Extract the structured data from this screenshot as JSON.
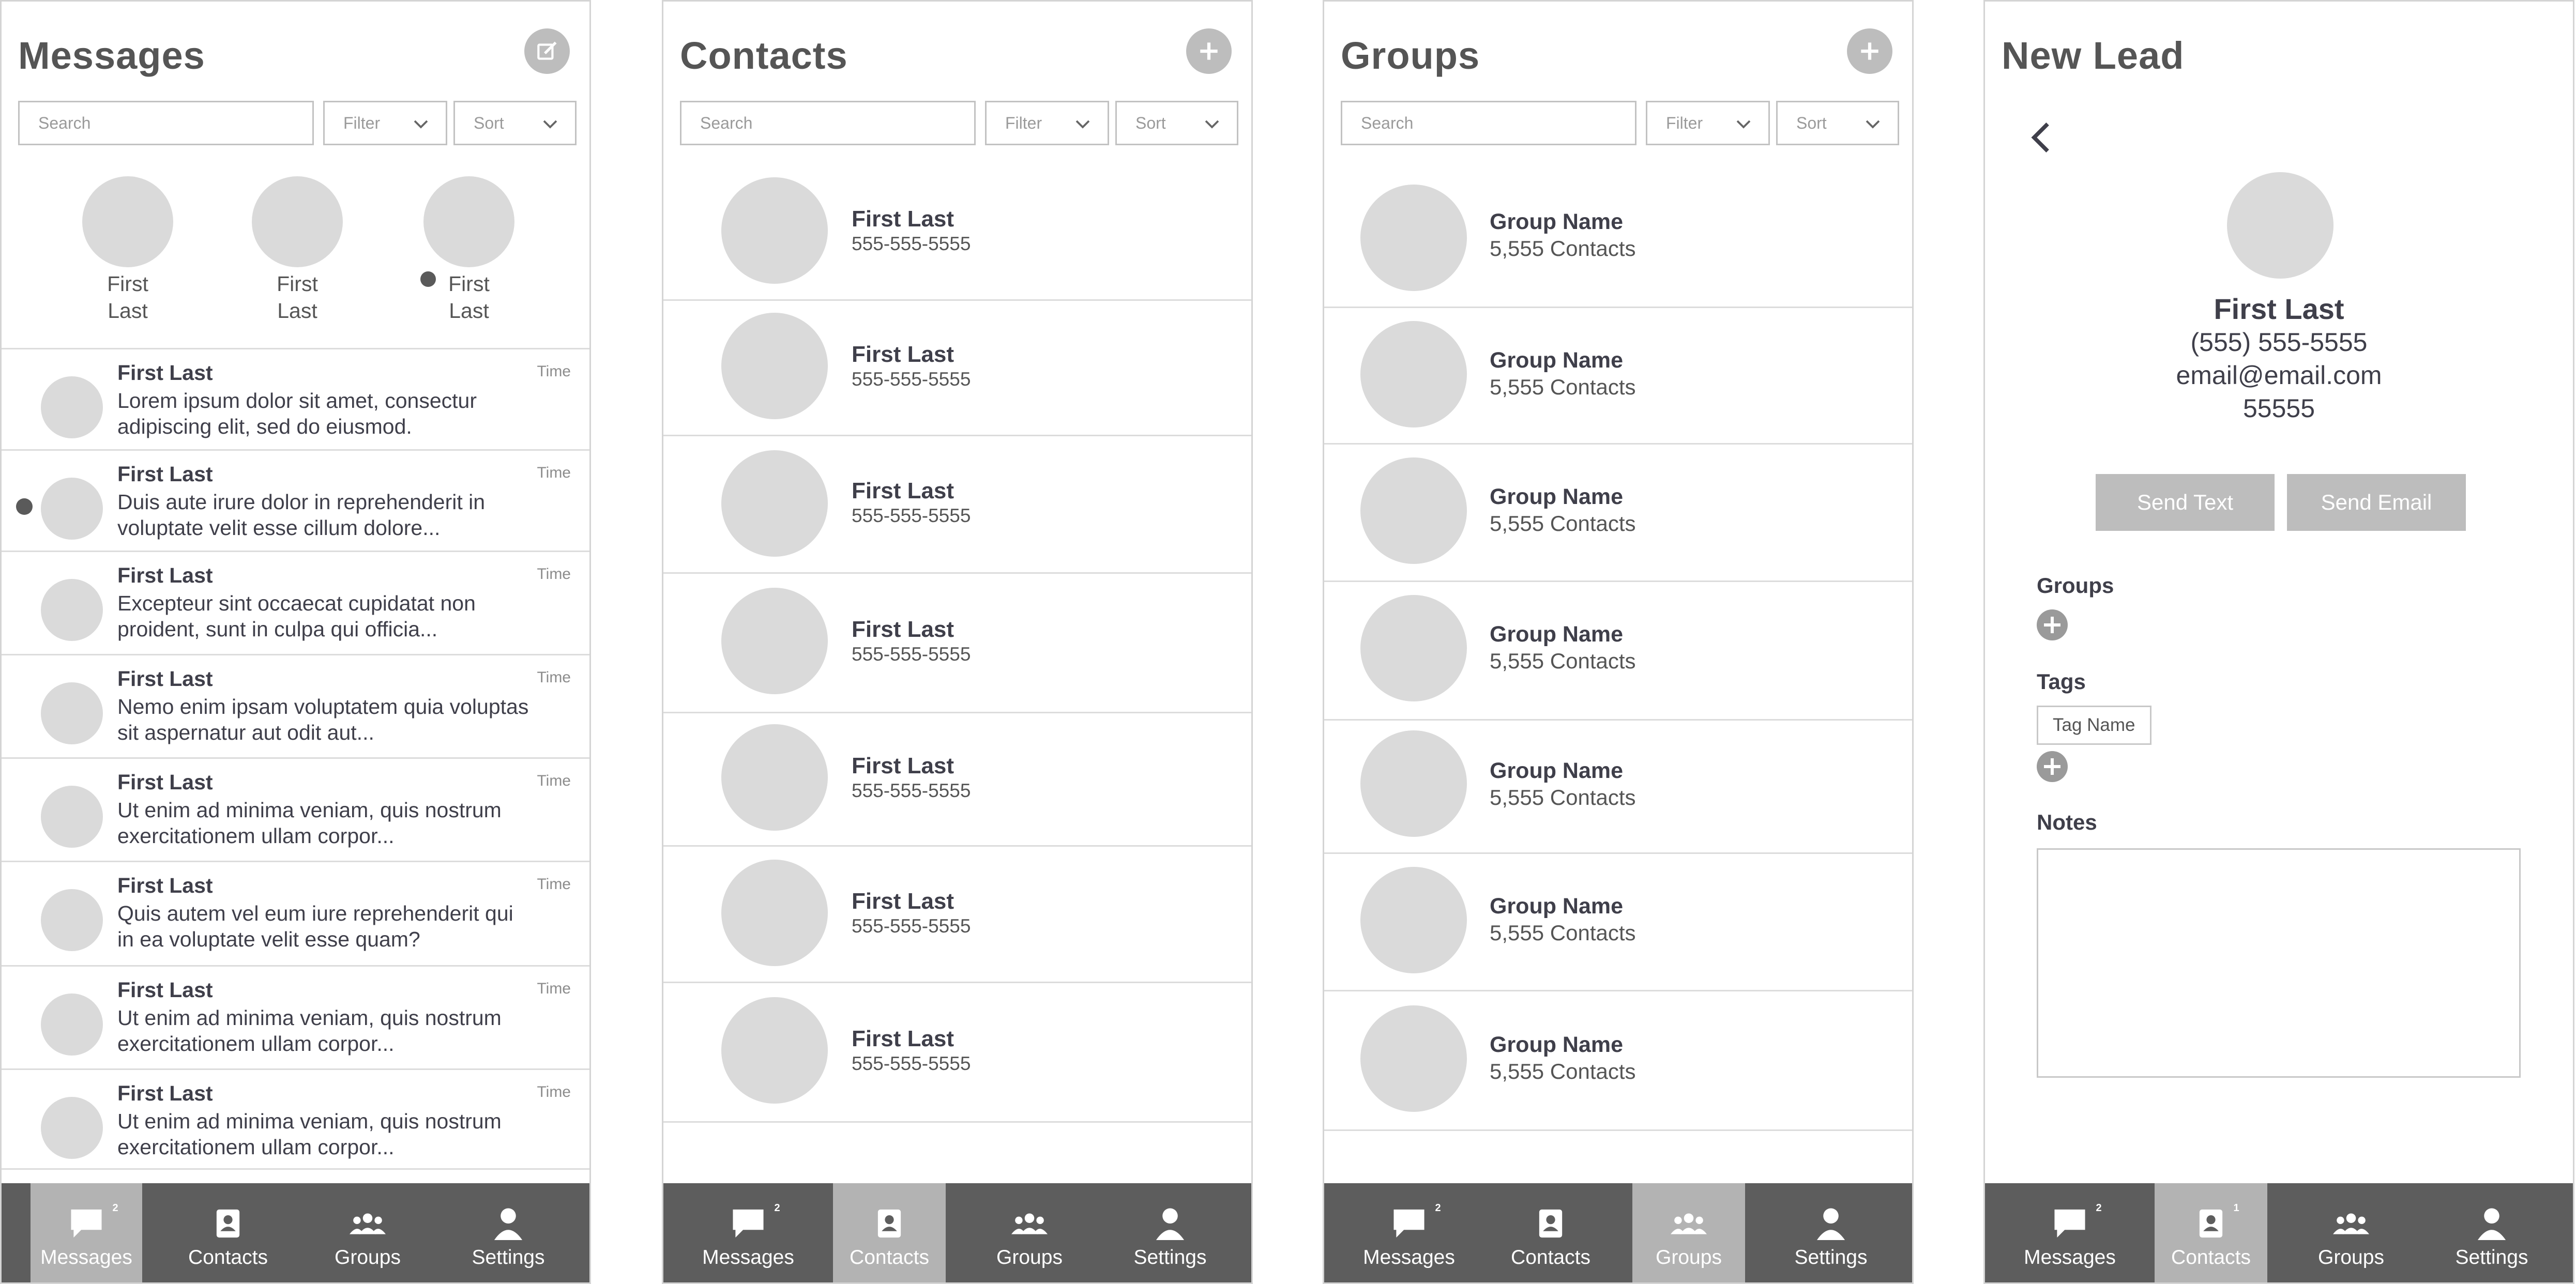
{
  "colors": {
    "nav_bg": "#5d5d5d",
    "nav_active": "#b3b3b3",
    "avatar": "#dadada",
    "button": "#bdbdbd"
  },
  "nav": {
    "messages": "Messages",
    "contacts": "Contacts",
    "groups": "Groups",
    "settings": "Settings",
    "messages_badge": "2",
    "contacts_badge": "1"
  },
  "search": {
    "placeholder": "Search",
    "filter": "Filter",
    "sort": "Sort"
  },
  "messages_screen": {
    "title": "Messages",
    "stories": [
      {
        "first": "First",
        "last": "Last"
      },
      {
        "first": "First",
        "last": "Last"
      },
      {
        "first": "First",
        "last": "Last"
      }
    ],
    "threads": [
      {
        "name": "First Last",
        "text": "Lorem ipsum dolor sit amet, consectur adipiscing elit, sed do eiusmod.",
        "time": "Time"
      },
      {
        "name": "First Last",
        "text": "Duis aute irure dolor in reprehenderit in voluptate velit esse cillum dolore...",
        "time": "Time"
      },
      {
        "name": "First Last",
        "text": "Excepteur sint occaecat cupidatat non proident, sunt in culpa qui officia...",
        "time": "Time"
      },
      {
        "name": "First Last",
        "text": "Nemo enim ipsam voluptatem quia voluptas sit aspernatur aut odit aut...",
        "time": "Time"
      },
      {
        "name": "First Last",
        "text": "Ut enim ad minima veniam, quis nostrum exercitationem ullam corpor...",
        "time": "Time"
      },
      {
        "name": "First Last",
        "text": "Quis autem vel eum iure reprehenderit qui in ea voluptate velit esse quam?",
        "time": "Time"
      },
      {
        "name": "First Last",
        "text": "Ut enim ad minima veniam, quis nostrum exercitationem ullam corpor...",
        "time": "Time"
      },
      {
        "name": "First Last",
        "text": "Ut enim ad minima veniam, quis nostrum exercitationem ullam corpor...",
        "time": "Time"
      }
    ]
  },
  "contacts_screen": {
    "title": "Contacts",
    "items": [
      {
        "name": "First Last",
        "phone": "555-555-5555"
      },
      {
        "name": "First Last",
        "phone": "555-555-5555"
      },
      {
        "name": "First Last",
        "phone": "555-555-5555"
      },
      {
        "name": "First Last",
        "phone": "555-555-5555"
      },
      {
        "name": "First Last",
        "phone": "555-555-5555"
      },
      {
        "name": "First Last",
        "phone": "555-555-5555"
      },
      {
        "name": "First Last",
        "phone": "555-555-5555"
      }
    ]
  },
  "groups_screen": {
    "title": "Groups",
    "items": [
      {
        "name": "Group Name",
        "count": "5,555 Contacts"
      },
      {
        "name": "Group Name",
        "count": "5,555 Contacts"
      },
      {
        "name": "Group Name",
        "count": "5,555 Contacts"
      },
      {
        "name": "Group Name",
        "count": "5,555 Contacts"
      },
      {
        "name": "Group Name",
        "count": "5,555 Contacts"
      },
      {
        "name": "Group Name",
        "count": "5,555 Contacts"
      },
      {
        "name": "Group Name",
        "count": "5,555 Contacts"
      }
    ]
  },
  "lead_screen": {
    "title": "New Lead",
    "name": "First Last",
    "phone": "(555) 555-5555",
    "email": "email@email.com",
    "zip": "55555",
    "send_text": "Send Text",
    "send_email": "Send Email",
    "groups_label": "Groups",
    "tags_label": "Tags",
    "tag_name": "Tag Name",
    "notes_label": "Notes"
  }
}
